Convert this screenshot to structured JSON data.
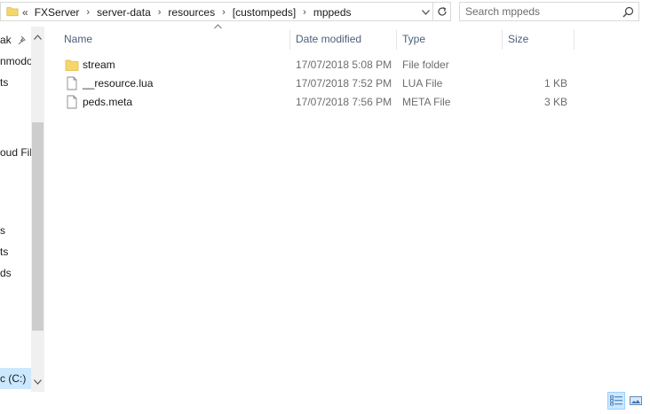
{
  "address": {
    "overflow": "«",
    "crumbs": [
      "FXServer",
      "server-data",
      "resources",
      "[custompeds]",
      "mppeds"
    ]
  },
  "search": {
    "placeholder": "Search mppeds"
  },
  "nav": {
    "items": [
      "ak",
      "nmodo",
      "ts",
      "oud Fil",
      "s",
      "ts",
      "ds"
    ],
    "drive": "c (C:)"
  },
  "columns": {
    "name": "Name",
    "date": "Date modified",
    "type": "Type",
    "size": "Size"
  },
  "files": [
    {
      "name": "stream",
      "date": "17/07/2018 5:08 PM",
      "type": "File folder",
      "size": "",
      "icon": "folder-icon"
    },
    {
      "name": "__resource.lua",
      "date": "17/07/2018 7:52 PM",
      "type": "LUA File",
      "size": "1 KB",
      "icon": "file-icon"
    },
    {
      "name": "peds.meta",
      "date": "17/07/2018 7:56 PM",
      "type": "META File",
      "size": "3 KB",
      "icon": "file-icon"
    }
  ],
  "colors": {
    "header_text": "#4c607a",
    "selection": "#cce8ff",
    "folder": "#f6d66b"
  }
}
